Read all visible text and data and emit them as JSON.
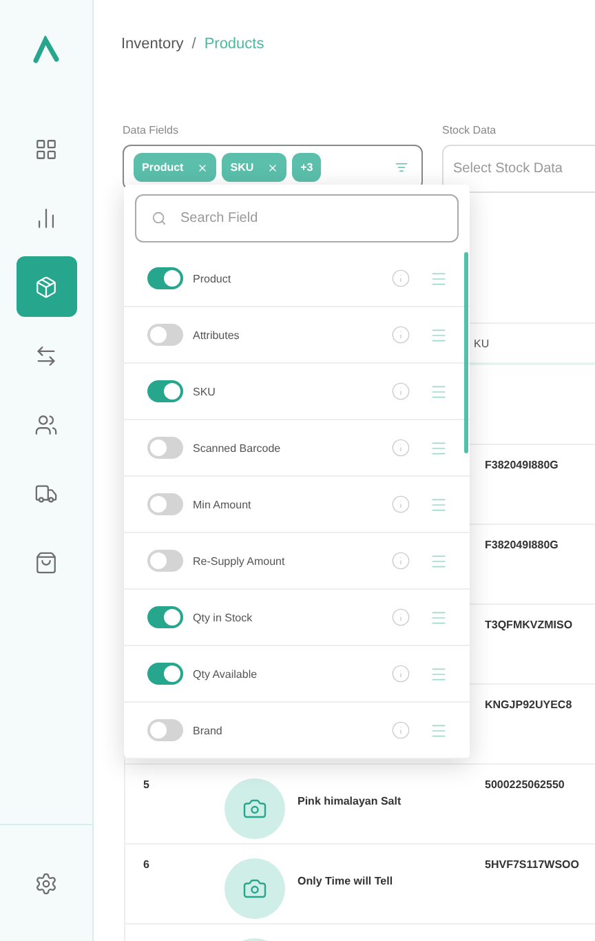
{
  "sidebar": {
    "items": [
      {
        "kind": "grid",
        "selected": false
      },
      {
        "kind": "chart",
        "selected": false
      },
      {
        "kind": "box",
        "selected": true
      },
      {
        "kind": "transfer",
        "selected": false
      },
      {
        "kind": "users",
        "selected": false
      },
      {
        "kind": "truck",
        "selected": false
      },
      {
        "kind": "bag",
        "selected": false
      }
    ]
  },
  "breadcrumb": {
    "separator": "/",
    "items": [
      {
        "label": "Inventory",
        "selected": false
      },
      {
        "label": "Products",
        "selected": true
      }
    ]
  },
  "filters": {
    "data_fields": {
      "label": "Data Fields",
      "chips": [
        {
          "label": "Product",
          "removable": true
        },
        {
          "label": "SKU",
          "removable": true
        },
        {
          "label": "+3",
          "removable": false
        }
      ]
    },
    "stock_data": {
      "label": "Stock Data",
      "placeholder": "Select Stock Data"
    }
  },
  "field_menu": {
    "search_placeholder": "Search Field",
    "fields": [
      {
        "label": "Product",
        "on": true
      },
      {
        "label": "Attributes",
        "on": false
      },
      {
        "label": "SKU",
        "on": true
      },
      {
        "label": "Scanned Barcode",
        "on": false
      },
      {
        "label": "Min Amount",
        "on": false
      },
      {
        "label": "Re-Supply Amount",
        "on": false
      },
      {
        "label": "Qty in Stock",
        "on": true
      },
      {
        "label": "Qty Available",
        "on": true
      },
      {
        "label": "Brand",
        "on": false
      }
    ]
  },
  "table": {
    "columns": [
      "KU"
    ],
    "rows": [
      {
        "sku": "F382049I880G"
      },
      {
        "sku": "F382049I880G"
      },
      {
        "sku": "T3QFMKVZMISO"
      },
      {
        "sku": "KNGJP92UYEC8"
      },
      {
        "index": "5",
        "photo": true,
        "name": "Pink himalayan Salt",
        "sku": "5000225062550"
      },
      {
        "index": "6",
        "photo": true,
        "name": "Only Time will Tell",
        "sku": "5HVF7S117WSOO"
      },
      {
        "photo": true
      }
    ]
  }
}
